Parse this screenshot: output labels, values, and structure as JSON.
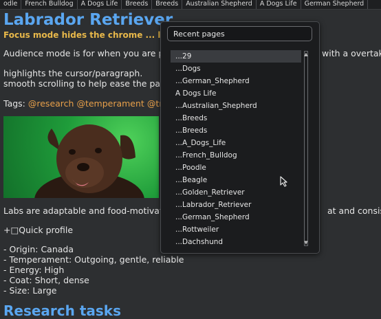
{
  "tabs": [
    "odle",
    "French Bulldog",
    "A Dogs Life",
    "Breeds",
    "Breeds",
    "Australian Shepherd",
    "A Dogs Life",
    "German Shepherd"
  ],
  "doc": {
    "title": "Labrador Retriever",
    "subtitle": "Focus mode hides the chrome ... le-t's",
    "para1": "Audience mode is for when you are pr",
    "para1_right": "with a overtak",
    "para2a": "highlights the cursor/paragraph.",
    "para2b": "smooth scrolling to help ease the pain",
    "tags_label": "Tags:",
    "tags": [
      "@research",
      "@temperament",
      "@tra"
    ],
    "para3": "Labs are adaptable and food-motivate",
    "para3_right": "at and consiste",
    "quick_profile": "+□Quick profile",
    "profile": [
      "- Origin: Canada",
      "- Temperament: Outgoing, gentle, reliable",
      "- Energy: High",
      "- Coat: Short, dense",
      "- Size: Large"
    ],
    "research_heading": "Research tasks"
  },
  "dropdown": {
    "search_value": "Recent pages",
    "items": [
      "...29",
      "...Dogs",
      "...German_Shepherd",
      "A Dogs Life",
      "...Australian_Shepherd",
      "...Breeds",
      "...Breeds",
      "...A_Dogs_Life",
      "...French_Bulldog",
      "...Poodle",
      "...Beagle",
      "...Golden_Retriever",
      "...Labrador_Retriever",
      "...German_Shepherd",
      "...Rottweiler",
      "...Dachshund"
    ],
    "selected_index": 0
  },
  "colors": {
    "accent": "#5aa6f0",
    "subtitle": "#e8b84a",
    "tag": "#e8a04a",
    "background": "#2d2f31"
  }
}
